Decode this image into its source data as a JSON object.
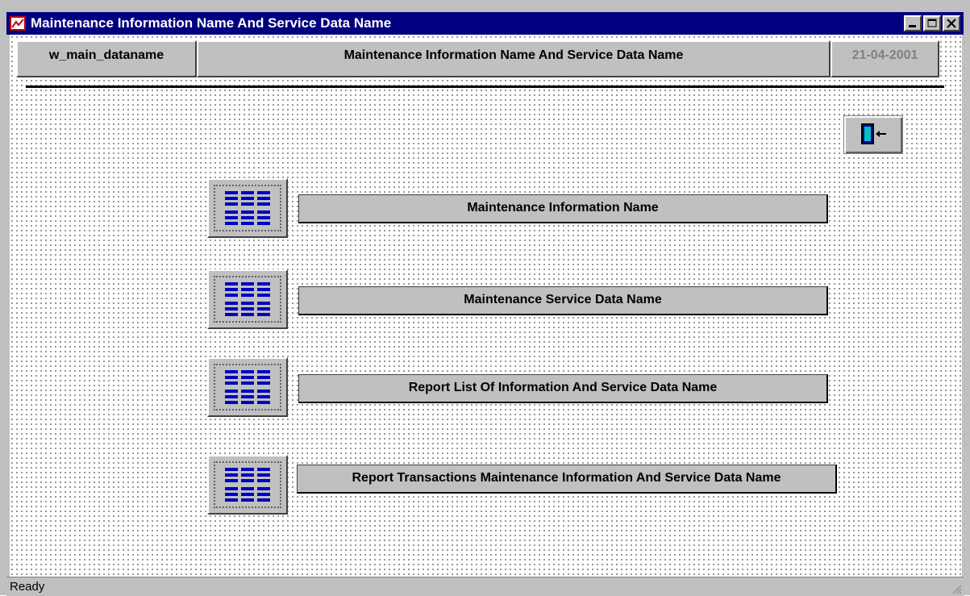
{
  "window": {
    "title": "Maintenance Information Name And Service Data Name",
    "controls": [
      "minimize",
      "maximize",
      "close"
    ]
  },
  "header": {
    "object_name": "w_main_dataname",
    "title": "Maintenance Information Name And Service Data Name",
    "date": "21-04-2001"
  },
  "menu": [
    {
      "label": "Maintenance Information Name",
      "icon": "grid-icon"
    },
    {
      "label": "Maintenance Service Data Name",
      "icon": "grid-icon"
    },
    {
      "label": "Report List Of Information And Service Data Name",
      "icon": "grid-icon"
    },
    {
      "label": "Report Transactions Maintenance Information And Service Data Name",
      "icon": "grid-icon"
    }
  ],
  "exit": {
    "icon": "exit-door-icon"
  },
  "status": {
    "text": "Ready"
  },
  "colors": {
    "titlebar": "#000080",
    "face": "#c0c0c0",
    "date_text": "#808080",
    "icon_blue": "#0000c0"
  }
}
